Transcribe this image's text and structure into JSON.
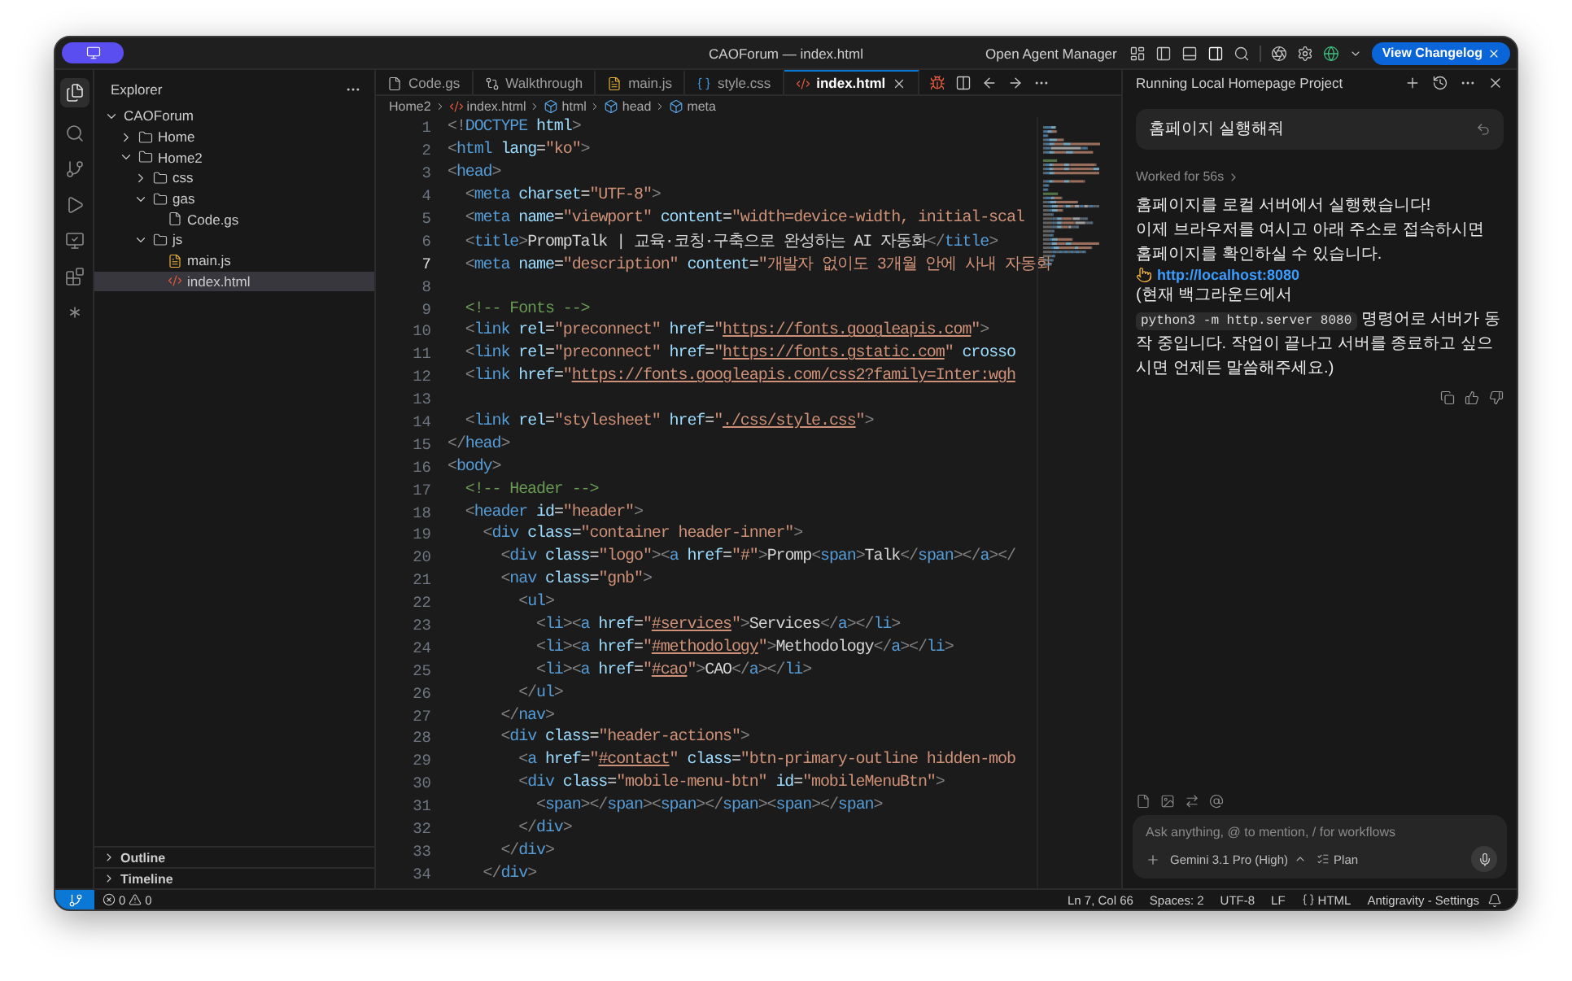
{
  "window": {
    "title": "CAOForum — index.html"
  },
  "title_bar": {
    "agent_manager": "Open Agent Manager",
    "changelog_button": "View Changelog"
  },
  "explorer": {
    "title": "Explorer",
    "tree": [
      {
        "name": "CAOForum",
        "kind": "folder",
        "expanded": true,
        "selected": false,
        "children": [
          {
            "name": "Home",
            "kind": "folder",
            "expanded": false,
            "selected": false
          },
          {
            "name": "Home2",
            "kind": "folder",
            "expanded": true,
            "selected": false,
            "children": [
              {
                "name": "css",
                "kind": "folder",
                "expanded": false,
                "selected": false
              },
              {
                "name": "gas",
                "kind": "folder",
                "expanded": true,
                "selected": false,
                "children": [
                  {
                    "name": "Code.gs",
                    "kind": "doc",
                    "selected": false
                  }
                ]
              },
              {
                "name": "js",
                "kind": "folder",
                "expanded": true,
                "selected": false,
                "children": [
                  {
                    "name": "main.js",
                    "kind": "js",
                    "selected": false
                  },
                  {
                    "name": "index.html",
                    "kind": "html",
                    "selected": true
                  }
                ]
              }
            ]
          }
        ]
      }
    ],
    "sections": [
      {
        "label": "Outline",
        "expanded": false
      },
      {
        "label": "Timeline",
        "expanded": false
      }
    ]
  },
  "tabs": [
    {
      "label": "Code.gs",
      "kind": "doc",
      "selected": false
    },
    {
      "label": "Walkthrough",
      "kind": "diff",
      "selected": false
    },
    {
      "label": "main.js",
      "kind": "js",
      "selected": false
    },
    {
      "label": "style.css",
      "kind": "css",
      "selected": false
    },
    {
      "label": "index.html",
      "kind": "html",
      "selected": true
    }
  ],
  "breadcrumb": [
    {
      "label": "Home2"
    },
    {
      "label": "index.html",
      "kind": "html"
    },
    {
      "label": "html",
      "kind": "element"
    },
    {
      "label": "head",
      "kind": "element"
    },
    {
      "label": "meta",
      "kind": "element"
    }
  ],
  "editor": {
    "lines": [
      {
        "number": "1",
        "active": false,
        "tokens": [
          {
            "kind": "punct",
            "text": "<!"
          },
          {
            "kind": "tag",
            "text": "DOCTYPE"
          },
          {
            "kind": "attr",
            "text": " html"
          },
          {
            "kind": "punct",
            "text": ">"
          }
        ]
      },
      {
        "number": "2",
        "active": false,
        "tokens": [
          {
            "kind": "punct",
            "text": "<"
          },
          {
            "kind": "tag",
            "text": "html"
          },
          {
            "kind": "attr",
            "text": " lang"
          },
          {
            "kind": "text",
            "text": "="
          },
          {
            "kind": "string",
            "text": "\"ko\""
          },
          {
            "kind": "punct",
            "text": ">"
          }
        ]
      },
      {
        "number": "3",
        "active": false,
        "tokens": [
          {
            "kind": "punct",
            "text": "<"
          },
          {
            "kind": "tag",
            "text": "head"
          },
          {
            "kind": "punct",
            "text": ">"
          }
        ]
      },
      {
        "number": "4",
        "active": false,
        "tokens": [
          {
            "kind": "punct",
            "text": "  <"
          },
          {
            "kind": "tag",
            "text": "meta"
          },
          {
            "kind": "attr",
            "text": " charset"
          },
          {
            "kind": "text",
            "text": "="
          },
          {
            "kind": "string",
            "text": "\"UTF-8\""
          },
          {
            "kind": "punct",
            "text": ">"
          }
        ]
      },
      {
        "number": "5",
        "active": false,
        "tokens": [
          {
            "kind": "punct",
            "text": "  <"
          },
          {
            "kind": "tag",
            "text": "meta"
          },
          {
            "kind": "attr",
            "text": " name"
          },
          {
            "kind": "text",
            "text": "="
          },
          {
            "kind": "string",
            "text": "\"viewport\""
          },
          {
            "kind": "attr",
            "text": " content"
          },
          {
            "kind": "text",
            "text": "="
          },
          {
            "kind": "string",
            "text": "\"width=device-width, initial-scal"
          }
        ]
      },
      {
        "number": "6",
        "active": false,
        "tokens": [
          {
            "kind": "punct",
            "text": "  <"
          },
          {
            "kind": "tag",
            "text": "title"
          },
          {
            "kind": "punct",
            "text": ">"
          },
          {
            "kind": "text",
            "text": "PrompTalk | 교육·코칭·구축으로 완성하는 AI 자동화"
          },
          {
            "kind": "punct",
            "text": "</"
          },
          {
            "kind": "tag",
            "text": "title"
          },
          {
            "kind": "punct",
            "text": ">"
          }
        ]
      },
      {
        "number": "7",
        "active": true,
        "tokens": [
          {
            "kind": "punct",
            "text": "  <"
          },
          {
            "kind": "tag",
            "text": "meta"
          },
          {
            "kind": "attr",
            "text": " name"
          },
          {
            "kind": "text",
            "text": "="
          },
          {
            "kind": "string",
            "text": "\"description\""
          },
          {
            "kind": "attr",
            "text": " content"
          },
          {
            "kind": "text",
            "text": "="
          },
          {
            "kind": "string",
            "text": "\"개발자 없이도 3개월 안에 사내 자동화"
          }
        ]
      },
      {
        "number": "8",
        "active": false
      },
      {
        "number": "9",
        "active": false,
        "tokens": [
          {
            "kind": "comment",
            "text": "  <!-- Fonts -->"
          }
        ]
      },
      {
        "number": "10",
        "active": false,
        "tokens": [
          {
            "kind": "punct",
            "text": "  <"
          },
          {
            "kind": "tag",
            "text": "link"
          },
          {
            "kind": "attr",
            "text": " rel"
          },
          {
            "kind": "text",
            "text": "="
          },
          {
            "kind": "string",
            "text": "\"preconnect\""
          },
          {
            "kind": "attr",
            "text": " href"
          },
          {
            "kind": "text",
            "text": "="
          },
          {
            "kind": "string",
            "text": "\""
          },
          {
            "kind": "url",
            "text": "https://fonts.googleapis.com"
          },
          {
            "kind": "string",
            "text": "\""
          },
          {
            "kind": "punct",
            "text": ">"
          }
        ]
      },
      {
        "number": "11",
        "active": false,
        "tokens": [
          {
            "kind": "punct",
            "text": "  <"
          },
          {
            "kind": "tag",
            "text": "link"
          },
          {
            "kind": "attr",
            "text": " rel"
          },
          {
            "kind": "text",
            "text": "="
          },
          {
            "kind": "string",
            "text": "\"preconnect\""
          },
          {
            "kind": "attr",
            "text": " href"
          },
          {
            "kind": "text",
            "text": "="
          },
          {
            "kind": "string",
            "text": "\""
          },
          {
            "kind": "url",
            "text": "https://fonts.gstatic.com"
          },
          {
            "kind": "string",
            "text": "\""
          },
          {
            "kind": "attr",
            "text": " crosso"
          }
        ]
      },
      {
        "number": "12",
        "active": false,
        "tokens": [
          {
            "kind": "punct",
            "text": "  <"
          },
          {
            "kind": "tag",
            "text": "link"
          },
          {
            "kind": "attr",
            "text": " href"
          },
          {
            "kind": "text",
            "text": "="
          },
          {
            "kind": "string",
            "text": "\""
          },
          {
            "kind": "url",
            "text": "https://fonts.googleapis.com/css2?family=Inter:wgh"
          }
        ]
      },
      {
        "number": "13",
        "active": false
      },
      {
        "number": "14",
        "active": false,
        "tokens": [
          {
            "kind": "punct",
            "text": "  <"
          },
          {
            "kind": "tag",
            "text": "link"
          },
          {
            "kind": "attr",
            "text": " rel"
          },
          {
            "kind": "text",
            "text": "="
          },
          {
            "kind": "string",
            "text": "\"stylesheet\""
          },
          {
            "kind": "attr",
            "text": " href"
          },
          {
            "kind": "text",
            "text": "="
          },
          {
            "kind": "string",
            "text": "\""
          },
          {
            "kind": "url",
            "text": "./css/style.css"
          },
          {
            "kind": "string",
            "text": "\""
          },
          {
            "kind": "punct",
            "text": ">"
          }
        ]
      },
      {
        "number": "15",
        "active": false,
        "tokens": [
          {
            "kind": "punct",
            "text": "</"
          },
          {
            "kind": "tag",
            "text": "head"
          },
          {
            "kind": "punct",
            "text": ">"
          }
        ]
      },
      {
        "number": "16",
        "active": false,
        "tokens": [
          {
            "kind": "punct",
            "text": "<"
          },
          {
            "kind": "tag",
            "text": "body"
          },
          {
            "kind": "punct",
            "text": ">"
          }
        ]
      },
      {
        "number": "17",
        "active": false,
        "tokens": [
          {
            "kind": "comment",
            "text": "  <!-- Header -->"
          }
        ]
      },
      {
        "number": "18",
        "active": false,
        "tokens": [
          {
            "kind": "punct",
            "text": "  <"
          },
          {
            "kind": "tag",
            "text": "header"
          },
          {
            "kind": "attr",
            "text": " id"
          },
          {
            "kind": "text",
            "text": "="
          },
          {
            "kind": "string",
            "text": "\"header\""
          },
          {
            "kind": "punct",
            "text": ">"
          }
        ]
      },
      {
        "number": "19",
        "active": false,
        "tokens": [
          {
            "kind": "punct",
            "text": "    <"
          },
          {
            "kind": "tag",
            "text": "div"
          },
          {
            "kind": "attr",
            "text": " class"
          },
          {
            "kind": "text",
            "text": "="
          },
          {
            "kind": "string",
            "text": "\"container header-inner\""
          },
          {
            "kind": "punct",
            "text": ">"
          }
        ]
      },
      {
        "number": "20",
        "active": false,
        "tokens": [
          {
            "kind": "punct",
            "text": "      <"
          },
          {
            "kind": "tag",
            "text": "div"
          },
          {
            "kind": "attr",
            "text": " class"
          },
          {
            "kind": "text",
            "text": "="
          },
          {
            "kind": "string",
            "text": "\"logo\""
          },
          {
            "kind": "punct",
            "text": "><"
          },
          {
            "kind": "tag",
            "text": "a"
          },
          {
            "kind": "attr",
            "text": " href"
          },
          {
            "kind": "text",
            "text": "="
          },
          {
            "kind": "string",
            "text": "\"#\""
          },
          {
            "kind": "punct",
            "text": ">"
          },
          {
            "kind": "text",
            "text": "Promp"
          },
          {
            "kind": "punct",
            "text": "<"
          },
          {
            "kind": "tag",
            "text": "span"
          },
          {
            "kind": "punct",
            "text": ">"
          },
          {
            "kind": "text",
            "text": "Talk"
          },
          {
            "kind": "punct",
            "text": "</"
          },
          {
            "kind": "tag",
            "text": "span"
          },
          {
            "kind": "punct",
            "text": "></"
          },
          {
            "kind": "tag",
            "text": "a"
          },
          {
            "kind": "punct",
            "text": "></"
          }
        ]
      },
      {
        "number": "21",
        "active": false,
        "tokens": [
          {
            "kind": "punct",
            "text": "      <"
          },
          {
            "kind": "tag",
            "text": "nav"
          },
          {
            "kind": "attr",
            "text": " class"
          },
          {
            "kind": "text",
            "text": "="
          },
          {
            "kind": "string",
            "text": "\"gnb\""
          },
          {
            "kind": "punct",
            "text": ">"
          }
        ]
      },
      {
        "number": "22",
        "active": false,
        "tokens": [
          {
            "kind": "punct",
            "text": "        <"
          },
          {
            "kind": "tag",
            "text": "ul"
          },
          {
            "kind": "punct",
            "text": ">"
          }
        ]
      },
      {
        "number": "23",
        "active": false,
        "tokens": [
          {
            "kind": "punct",
            "text": "          <"
          },
          {
            "kind": "tag",
            "text": "li"
          },
          {
            "kind": "punct",
            "text": "><"
          },
          {
            "kind": "tag",
            "text": "a"
          },
          {
            "kind": "attr",
            "text": " href"
          },
          {
            "kind": "text",
            "text": "="
          },
          {
            "kind": "string",
            "text": "\""
          },
          {
            "kind": "url",
            "text": "#services"
          },
          {
            "kind": "string",
            "text": "\""
          },
          {
            "kind": "punct",
            "text": ">"
          },
          {
            "kind": "text",
            "text": "Services"
          },
          {
            "kind": "punct",
            "text": "</"
          },
          {
            "kind": "tag",
            "text": "a"
          },
          {
            "kind": "punct",
            "text": "></"
          },
          {
            "kind": "tag",
            "text": "li"
          },
          {
            "kind": "punct",
            "text": ">"
          }
        ]
      },
      {
        "number": "24",
        "active": false,
        "tokens": [
          {
            "kind": "punct",
            "text": "          <"
          },
          {
            "kind": "tag",
            "text": "li"
          },
          {
            "kind": "punct",
            "text": "><"
          },
          {
            "kind": "tag",
            "text": "a"
          },
          {
            "kind": "attr",
            "text": " href"
          },
          {
            "kind": "text",
            "text": "="
          },
          {
            "kind": "string",
            "text": "\""
          },
          {
            "kind": "url",
            "text": "#methodology"
          },
          {
            "kind": "string",
            "text": "\""
          },
          {
            "kind": "punct",
            "text": ">"
          },
          {
            "kind": "text",
            "text": "Methodology"
          },
          {
            "kind": "punct",
            "text": "</"
          },
          {
            "kind": "tag",
            "text": "a"
          },
          {
            "kind": "punct",
            "text": "></"
          },
          {
            "kind": "tag",
            "text": "li"
          },
          {
            "kind": "punct",
            "text": ">"
          }
        ]
      },
      {
        "number": "25",
        "active": false,
        "tokens": [
          {
            "kind": "punct",
            "text": "          <"
          },
          {
            "kind": "tag",
            "text": "li"
          },
          {
            "kind": "punct",
            "text": "><"
          },
          {
            "kind": "tag",
            "text": "a"
          },
          {
            "kind": "attr",
            "text": " href"
          },
          {
            "kind": "text",
            "text": "="
          },
          {
            "kind": "string",
            "text": "\""
          },
          {
            "kind": "url",
            "text": "#cao"
          },
          {
            "kind": "string",
            "text": "\""
          },
          {
            "kind": "punct",
            "text": ">"
          },
          {
            "kind": "text",
            "text": "CAO"
          },
          {
            "kind": "punct",
            "text": "</"
          },
          {
            "kind": "tag",
            "text": "a"
          },
          {
            "kind": "punct",
            "text": "></"
          },
          {
            "kind": "tag",
            "text": "li"
          },
          {
            "kind": "punct",
            "text": ">"
          }
        ]
      },
      {
        "number": "26",
        "active": false,
        "tokens": [
          {
            "kind": "punct",
            "text": "        </"
          },
          {
            "kind": "tag",
            "text": "ul"
          },
          {
            "kind": "punct",
            "text": ">"
          }
        ]
      },
      {
        "number": "27",
        "active": false,
        "tokens": [
          {
            "kind": "punct",
            "text": "      </"
          },
          {
            "kind": "tag",
            "text": "nav"
          },
          {
            "kind": "punct",
            "text": ">"
          }
        ]
      },
      {
        "number": "28",
        "active": false,
        "tokens": [
          {
            "kind": "punct",
            "text": "      <"
          },
          {
            "kind": "tag",
            "text": "div"
          },
          {
            "kind": "attr",
            "text": " class"
          },
          {
            "kind": "text",
            "text": "="
          },
          {
            "kind": "string",
            "text": "\"header-actions\""
          },
          {
            "kind": "punct",
            "text": ">"
          }
        ]
      },
      {
        "number": "29",
        "active": false,
        "tokens": [
          {
            "kind": "punct",
            "text": "        <"
          },
          {
            "kind": "tag",
            "text": "a"
          },
          {
            "kind": "attr",
            "text": " href"
          },
          {
            "kind": "text",
            "text": "="
          },
          {
            "kind": "string",
            "text": "\""
          },
          {
            "kind": "url",
            "text": "#contact"
          },
          {
            "kind": "string",
            "text": "\""
          },
          {
            "kind": "attr",
            "text": " class"
          },
          {
            "kind": "text",
            "text": "="
          },
          {
            "kind": "string",
            "text": "\"btn-primary-outline hidden-mob"
          }
        ]
      },
      {
        "number": "30",
        "active": false,
        "tokens": [
          {
            "kind": "punct",
            "text": "        <"
          },
          {
            "kind": "tag",
            "text": "div"
          },
          {
            "kind": "attr",
            "text": " class"
          },
          {
            "kind": "text",
            "text": "="
          },
          {
            "kind": "string",
            "text": "\"mobile-menu-btn\""
          },
          {
            "kind": "attr",
            "text": " id"
          },
          {
            "kind": "text",
            "text": "="
          },
          {
            "kind": "string",
            "text": "\"mobileMenuBtn\""
          },
          {
            "kind": "punct",
            "text": ">"
          }
        ]
      },
      {
        "number": "31",
        "active": false,
        "tokens": [
          {
            "kind": "punct",
            "text": "          <"
          },
          {
            "kind": "tag",
            "text": "span"
          },
          {
            "kind": "punct",
            "text": "></"
          },
          {
            "kind": "tag",
            "text": "span"
          },
          {
            "kind": "punct",
            "text": "><"
          },
          {
            "kind": "tag",
            "text": "span"
          },
          {
            "kind": "punct",
            "text": "></"
          },
          {
            "kind": "tag",
            "text": "span"
          },
          {
            "kind": "punct",
            "text": "><"
          },
          {
            "kind": "tag",
            "text": "span"
          },
          {
            "kind": "punct",
            "text": "></"
          },
          {
            "kind": "tag",
            "text": "span"
          },
          {
            "kind": "punct",
            "text": ">"
          }
        ]
      },
      {
        "number": "32",
        "active": false,
        "tokens": [
          {
            "kind": "punct",
            "text": "        </"
          },
          {
            "kind": "tag",
            "text": "div"
          },
          {
            "kind": "punct",
            "text": ">"
          }
        ]
      },
      {
        "number": "33",
        "active": false,
        "tokens": [
          {
            "kind": "punct",
            "text": "      </"
          },
          {
            "kind": "tag",
            "text": "div"
          },
          {
            "kind": "punct",
            "text": ">"
          }
        ]
      },
      {
        "number": "34",
        "active": false,
        "tokens": [
          {
            "kind": "punct",
            "text": "    </"
          },
          {
            "kind": "tag",
            "text": "div"
          },
          {
            "kind": "punct",
            "text": ">"
          }
        ]
      }
    ]
  },
  "chat": {
    "title": "Running Local Homepage Project",
    "user_message": "홈페이지 실행해줘",
    "worked": "Worked for 56s",
    "reply_lines": [
      "홈페이지를 로컬 서버에서 실행했습니다!",
      "이제 브라우저를 여시고 아래 주소로 접속하시면 홈페이지를 확인하실 수 있습니다."
    ],
    "link": "http://localhost:8080",
    "note_before": "(현재 백그라운드에서",
    "note_code": "python3 -m http.server 8080",
    "note_after": "명령어로 서버가 동작 중입니다. 작업이 끝나고 서버를 종료하고 싶으시면 언제든 말씀해주세요.)",
    "input_placeholder": "Ask anything, @ to mention, / for workflows",
    "model": "Gemini 3.1 Pro (High)",
    "mode": "Plan"
  },
  "status_bar": {
    "errors": "0",
    "warnings": "0",
    "items": [
      {
        "label": "Ln 7, Col 66",
        "kind": "text"
      },
      {
        "label": "Spaces: 2",
        "kind": "text"
      },
      {
        "label": "UTF-8",
        "kind": "text"
      },
      {
        "label": "LF",
        "kind": "text"
      },
      {
        "label": "HTML",
        "kind": "language"
      },
      {
        "label": "Antigravity - Settings",
        "kind": "text"
      }
    ]
  }
}
